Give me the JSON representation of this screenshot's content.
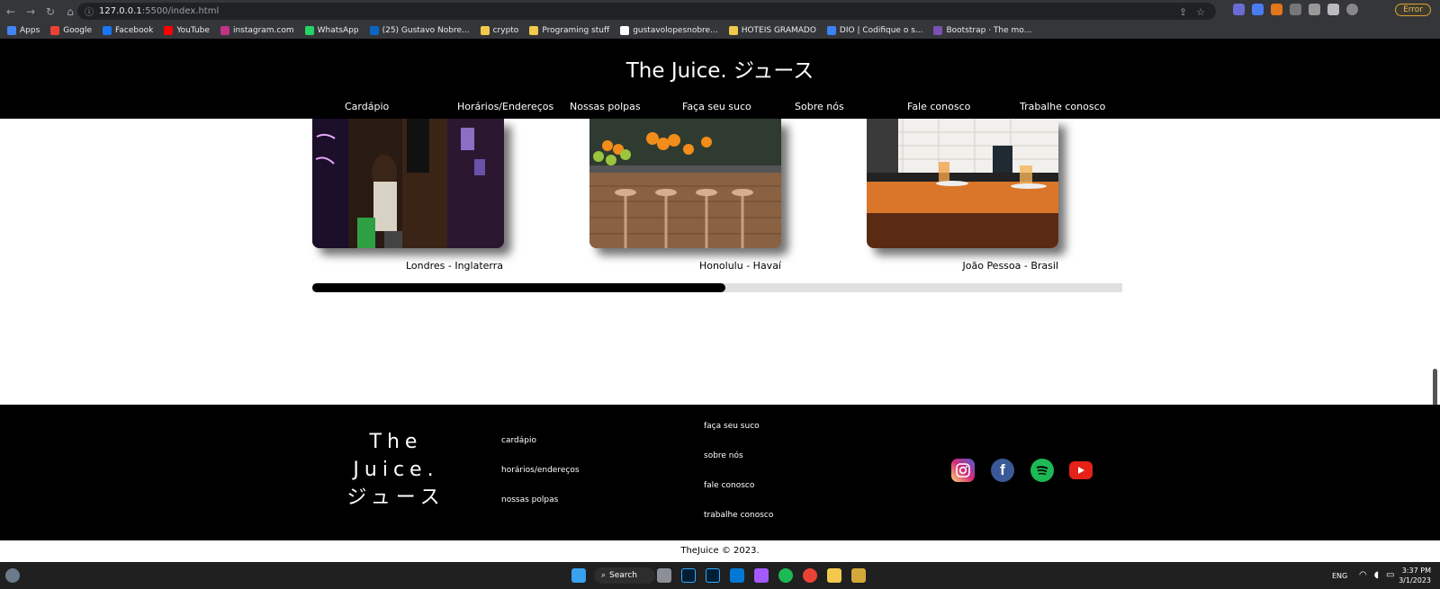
{
  "browser": {
    "url_host": "127.0.0.1",
    "url_path": ":5500/index.html",
    "error_label": "Error",
    "bookmarks": [
      {
        "label": "Apps",
        "icon": "apps-grid-icon",
        "color": "#4285f4"
      },
      {
        "label": "Google",
        "icon": "google-icon",
        "color": "#ea4335"
      },
      {
        "label": "Facebook",
        "icon": "facebook-icon",
        "color": "#1877f2"
      },
      {
        "label": "YouTube",
        "icon": "youtube-icon",
        "color": "#ff0000"
      },
      {
        "label": "instagram.com",
        "icon": "instagram-icon",
        "color": "#c13584"
      },
      {
        "label": "WhatsApp",
        "icon": "whatsapp-icon",
        "color": "#25d366"
      },
      {
        "label": "(25) Gustavo Nobre...",
        "icon": "linkedin-icon",
        "color": "#0a66c2"
      },
      {
        "label": "crypto",
        "icon": "folder-icon",
        "color": "#f2c94c"
      },
      {
        "label": "Programing stuff",
        "icon": "folder-icon",
        "color": "#f2c94c"
      },
      {
        "label": "gustavolopesnobre...",
        "icon": "github-icon",
        "color": "#ffffff"
      },
      {
        "label": "HOTEIS GRAMADO",
        "icon": "folder-icon",
        "color": "#f2c94c"
      },
      {
        "label": "DIO | Codifique o s...",
        "icon": "dio-icon",
        "color": "#3b82f6"
      },
      {
        "label": "Bootstrap · The mo...",
        "icon": "bootstrap-icon",
        "color": "#7952b3"
      }
    ]
  },
  "site": {
    "title": "The Juice. ジュース",
    "nav": [
      "Cardápio",
      "Horários/Endereços",
      "Nossas polpas",
      "Faça seu suco",
      "Sobre nós",
      "Fale conosco",
      "Trabalhe conosco"
    ]
  },
  "carousel": {
    "cards": [
      {
        "caption": "Londres - Inglaterra"
      },
      {
        "caption": "Honolulu - Havaí"
      },
      {
        "caption": "João Pessoa - Brasil"
      }
    ],
    "progress_fraction": 0.51
  },
  "footer": {
    "logo_lines": [
      "The",
      "Juice.",
      "ジュース"
    ],
    "links_col1": [
      "cardápio",
      "horários/endereços",
      "nossas polpas"
    ],
    "links_col2": [
      "faça seu suco",
      "sobre nós",
      "fale conosco",
      "trabalhe conosco"
    ],
    "social": [
      {
        "icon": "instagram-icon",
        "color": "#d62976"
      },
      {
        "icon": "facebook-icon",
        "color": "#3b5998"
      },
      {
        "icon": "spotify-icon",
        "color": "#1db954"
      },
      {
        "icon": "youtube-icon",
        "color": "#e62117"
      }
    ],
    "copyright": "TheJuice © 2023."
  },
  "taskbar": {
    "search_label": "Search",
    "lang": "ENG",
    "time": "3:37 PM",
    "date": "3/1/2023"
  }
}
